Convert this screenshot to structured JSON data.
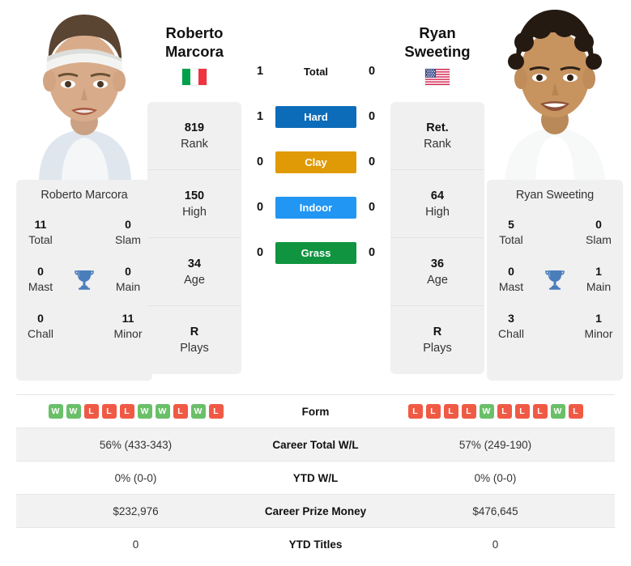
{
  "players": {
    "left": {
      "first_name": "Roberto",
      "last_name": "Marcora",
      "full_name": "Roberto Marcora",
      "country": "Italy",
      "flag_icon": "flag-italy-icon",
      "photo_name": "player-photo-roberto-marcora",
      "stats": [
        {
          "value": "819",
          "label": "Rank"
        },
        {
          "value": "150",
          "label": "High"
        },
        {
          "value": "34",
          "label": "Age"
        },
        {
          "value": "R",
          "label": "Plays"
        }
      ],
      "titles": {
        "total": "11",
        "slam": "0",
        "mast": "0",
        "main": "0",
        "chall": "0",
        "minor": "11"
      },
      "form": [
        "W",
        "W",
        "L",
        "L",
        "L",
        "W",
        "W",
        "L",
        "W",
        "L"
      ],
      "career_total_wl": "56% (433-343)",
      "ytd_wl": "0% (0-0)",
      "career_prize_money": "$232,976",
      "ytd_titles": "0"
    },
    "right": {
      "first_name": "Ryan",
      "last_name": "Sweeting",
      "full_name": "Ryan Sweeting",
      "country": "United States",
      "flag_icon": "flag-usa-icon",
      "photo_name": "player-photo-ryan-sweeting",
      "stats": [
        {
          "value": "Ret.",
          "label": "Rank"
        },
        {
          "value": "64",
          "label": "High"
        },
        {
          "value": "36",
          "label": "Age"
        },
        {
          "value": "R",
          "label": "Plays"
        }
      ],
      "titles": {
        "total": "5",
        "slam": "0",
        "mast": "0",
        "main": "1",
        "chall": "3",
        "minor": "1"
      },
      "form": [
        "L",
        "L",
        "L",
        "L",
        "W",
        "L",
        "L",
        "L",
        "W",
        "L"
      ],
      "career_total_wl": "57% (249-190)",
      "ytd_wl": "0% (0-0)",
      "career_prize_money": "$476,645",
      "ytd_titles": "0"
    }
  },
  "titles_labels": {
    "total": "Total",
    "slam": "Slam",
    "mast": "Mast",
    "main": "Main",
    "chall": "Chall",
    "minor": "Minor",
    "trophy_icon": "trophy-icon"
  },
  "head_to_head": [
    {
      "key": "total",
      "label": "Total",
      "left": "1",
      "right": "0",
      "style": "plain",
      "color": ""
    },
    {
      "key": "hard",
      "label": "Hard",
      "left": "1",
      "right": "0",
      "style": "pill",
      "color": "#0d6cb9"
    },
    {
      "key": "clay",
      "label": "Clay",
      "left": "0",
      "right": "0",
      "style": "pill",
      "color": "#e09a06"
    },
    {
      "key": "indoor",
      "label": "Indoor",
      "left": "0",
      "right": "0",
      "style": "pill",
      "color": "#2196f3"
    },
    {
      "key": "grass",
      "label": "Grass",
      "left": "0",
      "right": "0",
      "style": "pill",
      "color": "#109440"
    }
  ],
  "comparison_rows": [
    {
      "key": "form",
      "label": "Form",
      "type": "form",
      "left": "",
      "right": "",
      "shaded": false
    },
    {
      "key": "career_wl",
      "label": "Career Total W/L",
      "type": "text",
      "left": "56% (433-343)",
      "right": "57% (249-190)",
      "shaded": true
    },
    {
      "key": "ytd_wl",
      "label": "YTD W/L",
      "type": "text",
      "left": "0% (0-0)",
      "right": "0% (0-0)",
      "shaded": false
    },
    {
      "key": "prize_money",
      "label": "Career Prize Money",
      "type": "text",
      "left": "$232,976",
      "right": "$476,645",
      "shaded": true
    },
    {
      "key": "ytd_titles",
      "label": "YTD Titles",
      "type": "text",
      "left": "0",
      "right": "0",
      "shaded": false
    }
  ],
  "colors": {
    "hard": "#0d6cb9",
    "clay": "#e09a06",
    "indoor": "#2196f3",
    "grass": "#109440",
    "win": "#6abf69",
    "loss": "#f05a45",
    "trophy": "#4a7ebb",
    "card_bg": "#f0f0f0"
  }
}
